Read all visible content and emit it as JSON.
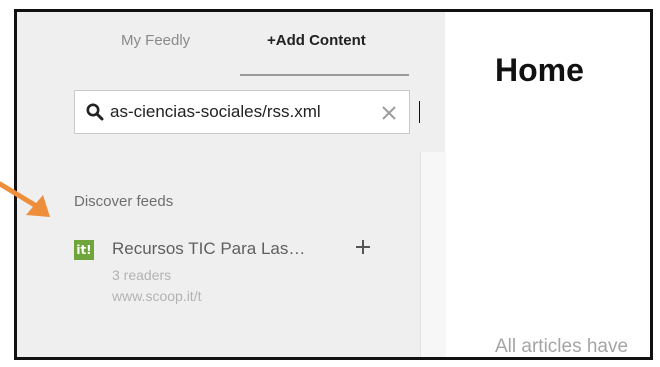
{
  "tabs": {
    "my_feedly": "My Feedly",
    "add_content": "+Add Content"
  },
  "search": {
    "value": "as-ciencias-sociales/rss.xml",
    "icons": {
      "search": "search-icon",
      "clear": "close-icon"
    }
  },
  "discover": {
    "section_title": "Discover feeds",
    "feeds": [
      {
        "logo": "it!",
        "title": "Recursos TIC Para Las…",
        "readers": "3 readers",
        "url": "www.scoop.it/t",
        "action_icon": "plus-icon"
      }
    ]
  },
  "main": {
    "title": "Home",
    "empty_message": "All articles have"
  },
  "colors": {
    "sidebar_bg": "#efefef",
    "logo_green": "#6fa53a",
    "arrow_orange": "#ee8d3a"
  }
}
